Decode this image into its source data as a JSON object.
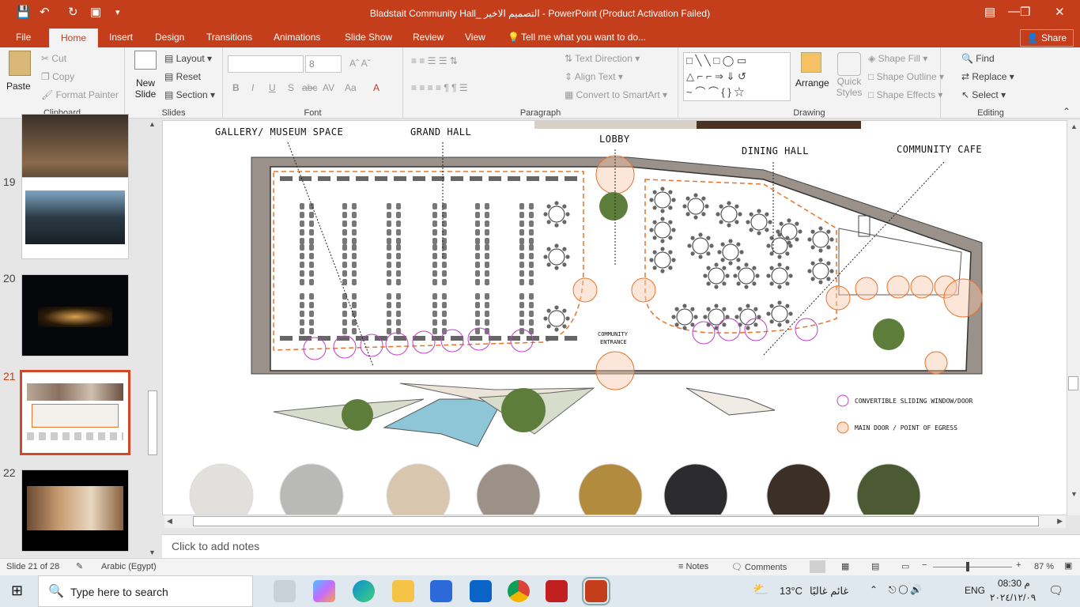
{
  "titlebar": {
    "title": "Bladstait Community Hall_ التصميم الاخير - PowerPoint (Product Activation Failed)",
    "minimize": "—",
    "restore": "❐",
    "close": "✕"
  },
  "tabs": [
    "File",
    "Home",
    "Insert",
    "Design",
    "Transitions",
    "Animations",
    "Slide Show",
    "Review",
    "View"
  ],
  "tell_me": "Tell me what you want to do...",
  "share": "Share",
  "clipboard": {
    "paste": "Paste",
    "cut": "Cut",
    "copy": "Copy",
    "format_painter": "Format Painter",
    "label": "Clipboard"
  },
  "slides_group": {
    "new_slide": "New",
    "new_slide2": "Slide",
    "layout": "Layout",
    "reset": "Reset",
    "section": "Section",
    "label": "Slides"
  },
  "font": {
    "size": "8",
    "label": "Font"
  },
  "paragraph": {
    "text_direction": "Text Direction",
    "align_text": "Align Text",
    "smartart": "Convert to SmartArt",
    "label": "Paragraph"
  },
  "drawing": {
    "arrange": "Arrange",
    "quick": "Quick",
    "styles": "Styles",
    "shape_fill": "Shape Fill",
    "shape_outline": "Shape Outline",
    "shape_effects": "Shape Effects",
    "label": "Drawing"
  },
  "editing": {
    "find": "Find",
    "replace": "Replace",
    "select": "Select",
    "label": "Editing"
  },
  "thumbs": [
    {
      "num": "19"
    },
    {
      "num": "20"
    },
    {
      "num": "21"
    },
    {
      "num": "22"
    }
  ],
  "slide": {
    "labels": {
      "gallery": "GALLERY/ MUSEUM SPACE",
      "grand_hall": "GRAND HALL",
      "lobby": "LOBBY",
      "dining": "DINING HALL",
      "cafe": "COMMUNITY CAFE",
      "entrance1": "COMMUNITY",
      "entrance2": "ENTRANCE"
    },
    "legend": {
      "window": "CONVERTIBLE SLIDING WINDOW/DOOR",
      "door": "MAIN DOOR / POINT OF EGRESS"
    },
    "materials": [
      "#e2e0dc",
      "#b9b9b8",
      "#d8c6ae",
      "#9c9186",
      "#b38b3e",
      "#2c2c2e",
      "#3b2f26",
      "#4c5a34"
    ]
  },
  "notes_placeholder": "Click to add notes",
  "status": {
    "slide": "Slide 21 of 28",
    "language": "Arabic (Egypt)",
    "notes": "Notes",
    "comments": "Comments",
    "zoom": "87 %"
  },
  "taskbar": {
    "search": "Type here to search",
    "weather": "13°C",
    "weather_desc": "غائم غالبًا",
    "lang": "ENG",
    "time": "08:30 م",
    "date": "٢٠٢٤/١٢/٠٩"
  }
}
